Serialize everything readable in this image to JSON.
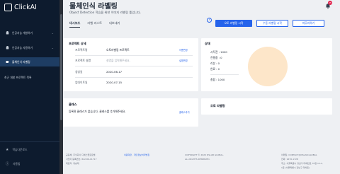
{
  "app": {
    "name": "ClickAI"
  },
  "sidebar": {
    "items": [
      {
        "label": "인공지능 개발하기"
      },
      {
        "label": "인공지능 사용하기"
      },
      {
        "label": "물체인식 라벨링"
      }
    ],
    "recent_title": "최근 개발 프로젝트 목록",
    "footer": [
      {
        "label": "학습다운로드"
      },
      {
        "label": "사용법"
      }
    ]
  },
  "header": {
    "title": "물체인식 라벨링",
    "subtitle": "Object Detection 학습을 위한 이미지 라벨링 툴입니다.",
    "notification_count": "25"
  },
  "tabs": [
    "대시보드",
    "라벨 리스트",
    "내보내기"
  ],
  "buttons": {
    "auto_label": "오토 라벨링 시작",
    "manual_label": "수동 라벨링 시작",
    "finish": "마무리하기"
  },
  "project_status": {
    "title": "프로젝트 상세",
    "rows": [
      {
        "label": "프로젝트명",
        "value": "오토라벨링 프로젝트",
        "edit": "이름변경"
      },
      {
        "label": "프로젝트 설명",
        "value": "설명을 입력해주세요.",
        "edit": "설명변경"
      },
      {
        "label": "생성일",
        "value": "2020-06-17"
      },
      {
        "label": "업데이트일",
        "value": "2020-07-15"
      }
    ]
  },
  "status": {
    "title": "상태",
    "lines": [
      "시작전 : 1000",
      "진행중 : 0",
      "리뷰 : 0",
      "완료 : 0"
    ],
    "total": "총합 : 1000"
  },
  "classes": {
    "title": "클래스",
    "empty_text": "등록된 클래스가 없습니다. 클래스를 추가해주세요.",
    "add": "클래스추가"
  },
  "auto_label_card": {
    "title": "오토 라벨링"
  },
  "footer": {
    "company_lines": [
      "공동체: 주식회사 디에스랩글로벌",
      "사업자 등록번호: 822-86-01717",
      "대표자: 유승재"
    ],
    "links": "이용약관 · 개인정보처리방침",
    "copyright": [
      "COPYRIGHT © 2020 DSLAB GLOBAL.",
      "ALL RIGHTS RESERVED."
    ],
    "contact": [
      "이메일: CONTACT@DSLAB.GLOBAL",
      "전화: 1670-1728",
      "주소: 서울특별시 강남구 테헤란로 70길 12-1,",
      "1층 (서울특별시 강남구 대치동)"
    ]
  }
}
